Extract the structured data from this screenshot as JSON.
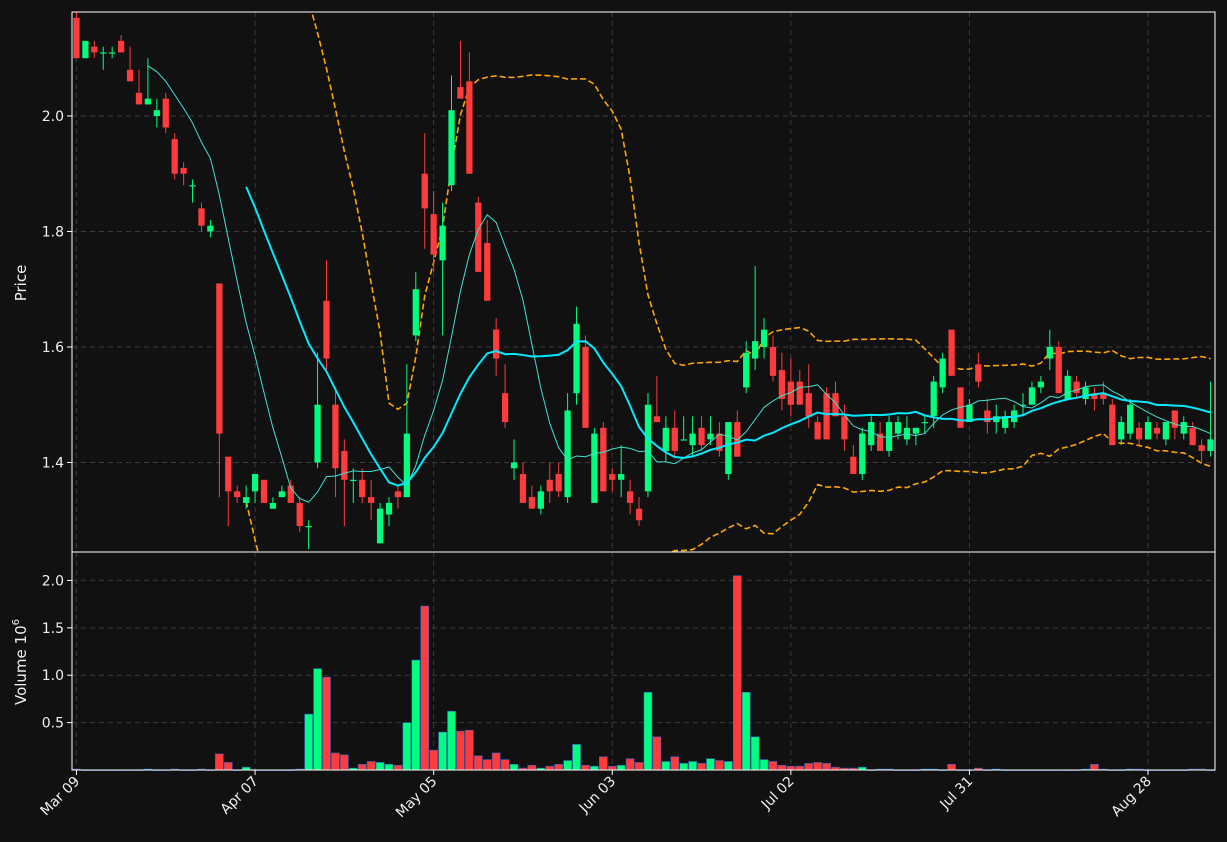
{
  "chart_data": {
    "type": "candlestick",
    "style": "dark",
    "colors": {
      "background": "#111111",
      "up": "#00ff7f",
      "down": "#ff3b3b",
      "ma_fast": "#40e0d0",
      "ma_slow": "#00eaff",
      "bands": "#ffa500",
      "grid": "#3a3a3a",
      "axis": "#ffffff"
    },
    "price_panel": {
      "ylabel": "Price",
      "ylim": [
        1.245,
        2.18
      ],
      "yticks": [
        1.4,
        1.6,
        1.8,
        2.0
      ],
      "ytick_labels": [
        "1.4",
        "1.6",
        "1.8",
        "2.0"
      ],
      "grid": true
    },
    "volume_panel": {
      "ylabel": "Volume",
      "exponent_label": "10",
      "exponent_sup": "6",
      "ylim": [
        0,
        2.3
      ],
      "yticks": [
        0.5,
        1.0,
        1.5,
        2.0
      ],
      "ytick_labels": [
        "0.5",
        "1.0",
        "1.5",
        "2.0"
      ],
      "grid": true
    },
    "x_ticks": [
      {
        "i": 0,
        "label": "Mar 09"
      },
      {
        "i": 20,
        "label": "Apr 07"
      },
      {
        "i": 40,
        "label": "May 05"
      },
      {
        "i": 60,
        "label": "Jun 03"
      },
      {
        "i": 80,
        "label": "Jul 02"
      },
      {
        "i": 100,
        "label": "Jul 31"
      },
      {
        "i": 120,
        "label": "Aug 28"
      }
    ],
    "n_bars": 128,
    "ohlc": [
      [
        2.17,
        2.18,
        2.1,
        2.1
      ],
      [
        2.1,
        2.13,
        2.1,
        2.13
      ],
      [
        2.12,
        2.13,
        2.1,
        2.11
      ],
      [
        2.11,
        2.12,
        2.08,
        2.11
      ],
      [
        2.11,
        2.12,
        2.1,
        2.11
      ],
      [
        2.13,
        2.14,
        2.11,
        2.11
      ],
      [
        2.08,
        2.12,
        2.06,
        2.06
      ],
      [
        2.04,
        2.08,
        2.02,
        2.02
      ],
      [
        2.02,
        2.1,
        2.02,
        2.03
      ],
      [
        2.0,
        2.03,
        1.98,
        2.01
      ],
      [
        2.03,
        2.04,
        1.97,
        1.98
      ],
      [
        1.96,
        1.97,
        1.89,
        1.9
      ],
      [
        1.91,
        1.92,
        1.88,
        1.9
      ],
      [
        1.88,
        1.89,
        1.85,
        1.88
      ],
      [
        1.84,
        1.85,
        1.8,
        1.81
      ],
      [
        1.8,
        1.82,
        1.79,
        1.81
      ],
      [
        1.71,
        1.71,
        1.34,
        1.45
      ],
      [
        1.41,
        1.41,
        1.29,
        1.35
      ],
      [
        1.35,
        1.36,
        1.33,
        1.34
      ],
      [
        1.33,
        1.36,
        1.32,
        1.34
      ],
      [
        1.35,
        1.38,
        1.33,
        1.38
      ],
      [
        1.37,
        1.37,
        1.33,
        1.33
      ],
      [
        1.32,
        1.34,
        1.32,
        1.33
      ],
      [
        1.34,
        1.36,
        1.34,
        1.35
      ],
      [
        1.36,
        1.37,
        1.33,
        1.33
      ],
      [
        1.33,
        1.34,
        1.28,
        1.29
      ],
      [
        1.29,
        1.3,
        1.25,
        1.29
      ],
      [
        1.4,
        1.59,
        1.39,
        1.5
      ],
      [
        1.68,
        1.75,
        1.56,
        1.58
      ],
      [
        1.5,
        1.53,
        1.34,
        1.39
      ],
      [
        1.42,
        1.44,
        1.29,
        1.37
      ],
      [
        1.37,
        1.39,
        1.33,
        1.37
      ],
      [
        1.37,
        1.39,
        1.33,
        1.34
      ],
      [
        1.34,
        1.37,
        1.3,
        1.33
      ],
      [
        1.26,
        1.33,
        1.26,
        1.32
      ],
      [
        1.31,
        1.34,
        1.29,
        1.33
      ],
      [
        1.35,
        1.36,
        1.32,
        1.34
      ],
      [
        1.34,
        1.57,
        1.34,
        1.45
      ],
      [
        1.62,
        1.73,
        1.61,
        1.7
      ],
      [
        1.9,
        1.97,
        1.77,
        1.84
      ],
      [
        1.83,
        1.87,
        1.73,
        1.76
      ],
      [
        1.75,
        1.85,
        1.62,
        1.81
      ],
      [
        1.88,
        2.07,
        1.87,
        2.01
      ],
      [
        2.05,
        2.13,
        2.03,
        2.03
      ],
      [
        2.06,
        2.11,
        1.9,
        1.9
      ],
      [
        1.85,
        1.86,
        1.73,
        1.73
      ],
      [
        1.78,
        1.82,
        1.68,
        1.68
      ],
      [
        1.63,
        1.65,
        1.55,
        1.58
      ],
      [
        1.52,
        1.57,
        1.46,
        1.47
      ],
      [
        1.39,
        1.44,
        1.37,
        1.4
      ],
      [
        1.38,
        1.4,
        1.33,
        1.33
      ],
      [
        1.34,
        1.36,
        1.32,
        1.32
      ],
      [
        1.32,
        1.36,
        1.31,
        1.35
      ],
      [
        1.37,
        1.4,
        1.33,
        1.35
      ],
      [
        1.38,
        1.4,
        1.34,
        1.35
      ],
      [
        1.34,
        1.52,
        1.33,
        1.49
      ],
      [
        1.52,
        1.67,
        1.5,
        1.64
      ],
      [
        1.6,
        1.62,
        1.46,
        1.46
      ],
      [
        1.33,
        1.46,
        1.33,
        1.45
      ],
      [
        1.46,
        1.47,
        1.35,
        1.35
      ],
      [
        1.38,
        1.39,
        1.35,
        1.37
      ],
      [
        1.37,
        1.43,
        1.34,
        1.38
      ],
      [
        1.35,
        1.37,
        1.31,
        1.33
      ],
      [
        1.32,
        1.34,
        1.29,
        1.3
      ],
      [
        1.35,
        1.52,
        1.34,
        1.5
      ],
      [
        1.48,
        1.55,
        1.47,
        1.47
      ],
      [
        1.42,
        1.48,
        1.4,
        1.46
      ],
      [
        1.46,
        1.49,
        1.41,
        1.42
      ],
      [
        1.44,
        1.48,
        1.44,
        1.44
      ],
      [
        1.43,
        1.48,
        1.41,
        1.45
      ],
      [
        1.46,
        1.48,
        1.42,
        1.43
      ],
      [
        1.44,
        1.48,
        1.43,
        1.45
      ],
      [
        1.45,
        1.47,
        1.41,
        1.42
      ],
      [
        1.38,
        1.47,
        1.37,
        1.47
      ],
      [
        1.47,
        1.49,
        1.41,
        1.41
      ],
      [
        1.53,
        1.61,
        1.52,
        1.59
      ],
      [
        1.58,
        1.74,
        1.56,
        1.61
      ],
      [
        1.6,
        1.65,
        1.58,
        1.63
      ],
      [
        1.6,
        1.62,
        1.54,
        1.55
      ],
      [
        1.56,
        1.59,
        1.49,
        1.51
      ],
      [
        1.54,
        1.58,
        1.48,
        1.5
      ],
      [
        1.54,
        1.56,
        1.5,
        1.5
      ],
      [
        1.52,
        1.57,
        1.46,
        1.48
      ],
      [
        1.47,
        1.48,
        1.44,
        1.44
      ],
      [
        1.52,
        1.53,
        1.44,
        1.44
      ],
      [
        1.52,
        1.54,
        1.48,
        1.48
      ],
      [
        1.48,
        1.5,
        1.42,
        1.44
      ],
      [
        1.41,
        1.43,
        1.38,
        1.38
      ],
      [
        1.38,
        1.46,
        1.37,
        1.45
      ],
      [
        1.43,
        1.48,
        1.42,
        1.47
      ],
      [
        1.45,
        1.47,
        1.42,
        1.42
      ],
      [
        1.42,
        1.48,
        1.41,
        1.47
      ],
      [
        1.45,
        1.48,
        1.44,
        1.47
      ],
      [
        1.44,
        1.48,
        1.43,
        1.46
      ],
      [
        1.45,
        1.46,
        1.43,
        1.46
      ],
      [
        1.47,
        1.48,
        1.45,
        1.47
      ],
      [
        1.48,
        1.55,
        1.46,
        1.54
      ],
      [
        1.53,
        1.59,
        1.52,
        1.58
      ],
      [
        1.63,
        1.63,
        1.55,
        1.55
      ],
      [
        1.53,
        1.53,
        1.46,
        1.46
      ],
      [
        1.47,
        1.51,
        1.47,
        1.5
      ],
      [
        1.57,
        1.59,
        1.53,
        1.54
      ],
      [
        1.49,
        1.51,
        1.45,
        1.47
      ],
      [
        1.47,
        1.5,
        1.45,
        1.48
      ],
      [
        1.46,
        1.49,
        1.45,
        1.48
      ],
      [
        1.47,
        1.5,
        1.46,
        1.49
      ],
      [
        1.5,
        1.52,
        1.48,
        1.5
      ],
      [
        1.5,
        1.54,
        1.5,
        1.53
      ],
      [
        1.53,
        1.55,
        1.52,
        1.54
      ],
      [
        1.58,
        1.63,
        1.56,
        1.6
      ],
      [
        1.6,
        1.61,
        1.52,
        1.52
      ],
      [
        1.51,
        1.56,
        1.51,
        1.55
      ],
      [
        1.54,
        1.55,
        1.51,
        1.52
      ],
      [
        1.51,
        1.54,
        1.5,
        1.53
      ],
      [
        1.52,
        1.53,
        1.49,
        1.51
      ],
      [
        1.52,
        1.54,
        1.5,
        1.51
      ],
      [
        1.5,
        1.51,
        1.43,
        1.43
      ],
      [
        1.44,
        1.48,
        1.43,
        1.47
      ],
      [
        1.45,
        1.51,
        1.44,
        1.5
      ],
      [
        1.46,
        1.47,
        1.43,
        1.44
      ],
      [
        1.44,
        1.48,
        1.44,
        1.47
      ],
      [
        1.46,
        1.47,
        1.44,
        1.45
      ],
      [
        1.44,
        1.47,
        1.43,
        1.47
      ],
      [
        1.49,
        1.49,
        1.44,
        1.46
      ],
      [
        1.45,
        1.48,
        1.44,
        1.47
      ],
      [
        1.46,
        1.47,
        1.43,
        1.43
      ],
      [
        1.43,
        1.44,
        1.4,
        1.42
      ],
      [
        1.42,
        1.54,
        1.41,
        1.44
      ]
    ],
    "volume": [
      0.01,
      0.0,
      0.0,
      0.0,
      0.0,
      0.0,
      0.0,
      0.0,
      0.01,
      0.0,
      0.0,
      0.01,
      0.0,
      0.0,
      0.01,
      0.0,
      0.17,
      0.08,
      0.0,
      0.03,
      0.0,
      0.0,
      0.0,
      0.0,
      0.0,
      0.01,
      0.59,
      1.07,
      0.98,
      0.18,
      0.16,
      0.02,
      0.06,
      0.09,
      0.08,
      0.06,
      0.05,
      0.5,
      1.16,
      1.73,
      0.21,
      0.4,
      0.62,
      0.41,
      0.42,
      0.15,
      0.11,
      0.18,
      0.11,
      0.06,
      0.02,
      0.05,
      0.02,
      0.04,
      0.06,
      0.1,
      0.27,
      0.05,
      0.04,
      0.14,
      0.04,
      0.05,
      0.12,
      0.08,
      0.82,
      0.35,
      0.09,
      0.14,
      0.07,
      0.09,
      0.07,
      0.12,
      0.1,
      0.09,
      2.05,
      0.82,
      0.35,
      0.11,
      0.09,
      0.05,
      0.04,
      0.04,
      0.07,
      0.08,
      0.07,
      0.03,
      0.02,
      0.02,
      0.03,
      0.0,
      0.01,
      0.01,
      0.0,
      0.0,
      0.0,
      0.01,
      0.01,
      0.0,
      0.06,
      0.0,
      0.0,
      0.02,
      0.0,
      0.01,
      0.0,
      0.0,
      0.0,
      0.0,
      0.0,
      0.0,
      0.0,
      0.0,
      0.0,
      0.01,
      0.06,
      0.01,
      0.0,
      0.0,
      0.01,
      0.01,
      0.0,
      0.0,
      0.0,
      0.0,
      0.0,
      0.01,
      0.01,
      0.0
    ]
  }
}
